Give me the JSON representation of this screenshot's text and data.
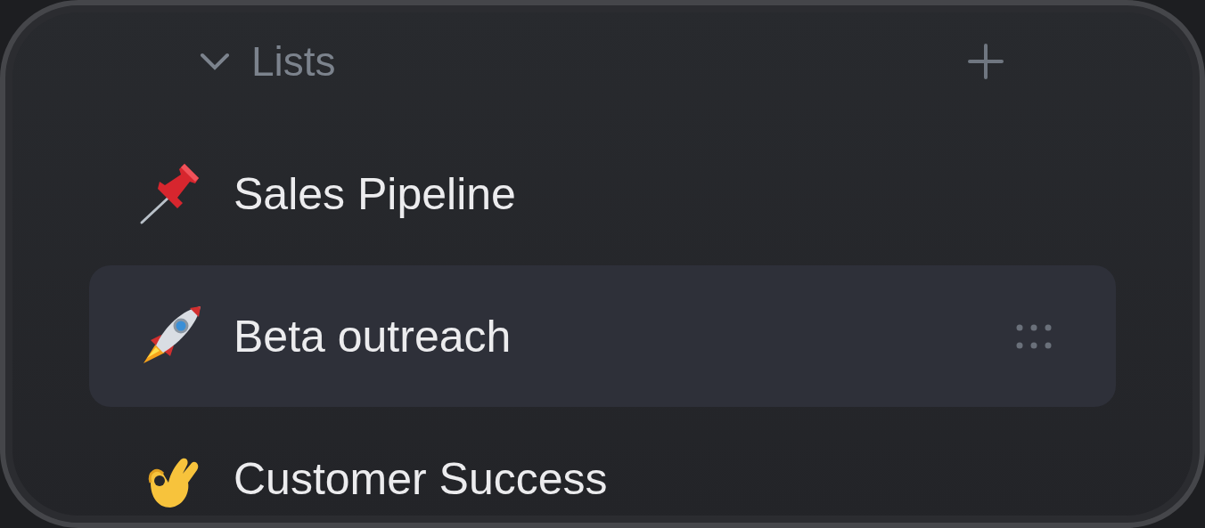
{
  "section": {
    "title": "Lists",
    "expanded": true
  },
  "lists": [
    {
      "label": "Sales Pipeline",
      "selected": false
    },
    {
      "label": "Beta outreach",
      "selected": true
    },
    {
      "label": "Customer Success",
      "selected": false
    }
  ]
}
